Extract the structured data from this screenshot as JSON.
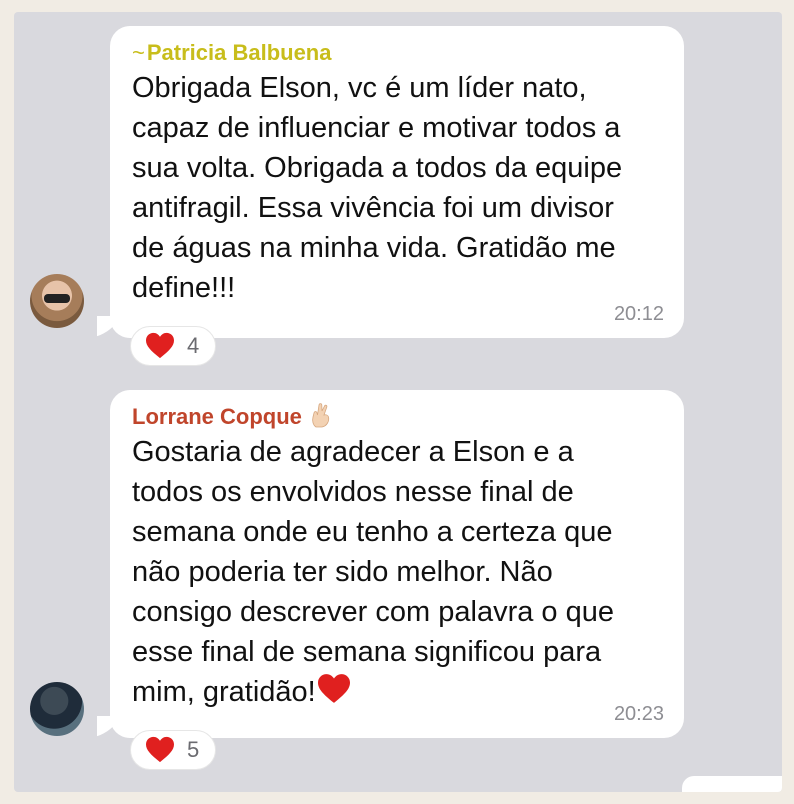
{
  "messages": [
    {
      "sender_prefix": "~",
      "sender": "Patricia Balbuena",
      "text": "Obrigada Elson, vc é um líder nato,\ncapaz de influenciar e motivar todos a\nsua volta. Obrigada a todos da equipe\nantifragil. Essa vivência foi um divisor\nde águas na minha vida. Gratidão me\ndefine!!!",
      "time": "20:12",
      "reaction_count": "4",
      "reaction_icon": "red-heart-icon"
    },
    {
      "sender": "Lorrane Copque",
      "sender_emoji": "crossed-fingers-icon",
      "text": "Gostaria de agradecer a Elson e a\ntodos os envolvidos nesse final de\nsemana onde eu tenho a certeza que\nnão poderia ter sido melhor. Não\nconsigo descrever com palavra o que\nesse final de semana significou para\nmim, gratidão!",
      "text_trailing_emoji": "red-heart-icon",
      "time": "20:23",
      "reaction_count": "5",
      "reaction_icon": "red-heart-icon"
    }
  ],
  "colors": {
    "background": "#f1ece4",
    "chat_area": "#d9d9de",
    "sender_1": "#c8bd1b",
    "sender_2": "#c0452b",
    "heart": "#e0201f"
  }
}
